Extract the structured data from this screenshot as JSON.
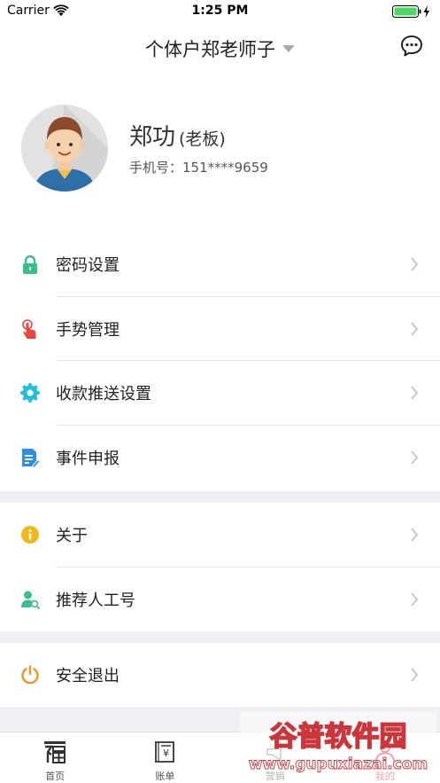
{
  "status_bar": {
    "carrier": "Carrier",
    "time": "1:25 PM"
  },
  "nav": {
    "title": "个体户郑老师子"
  },
  "profile": {
    "name": "郑功",
    "role": "(老板)",
    "phone": "手机号：151****9659"
  },
  "menu_group_1": [
    {
      "label": "密码设置",
      "icon": "lock-icon",
      "color": "#3bbf8a"
    },
    {
      "label": "手势管理",
      "icon": "hand-tap-icon",
      "color": "#e8453c"
    },
    {
      "label": "收款推送设置",
      "icon": "gear-icon",
      "color": "#1fc0d6"
    },
    {
      "label": "事件申报",
      "icon": "document-edit-icon",
      "color": "#2f8ce8"
    }
  ],
  "menu_group_2": [
    {
      "label": "关于",
      "icon": "info-icon",
      "color": "#f2b71b"
    },
    {
      "label": "推荐人工号",
      "icon": "user-search-icon",
      "color": "#3bbf8a"
    }
  ],
  "menu_group_3": [
    {
      "label": "安全退出",
      "icon": "power-icon",
      "color": "#f0932b"
    }
  ],
  "tabs": [
    {
      "label": "首页",
      "icon": "home-fu-icon"
    },
    {
      "label": "账单",
      "icon": "bill-icon"
    },
    {
      "label": "营销",
      "icon": "marketing-icon"
    },
    {
      "label": "我的",
      "icon": "profile-icon"
    }
  ],
  "watermark": {
    "line1": "谷普软件园",
    "line2": "www.gupuxiazai.com"
  },
  "colors": {
    "accent_red": "#d9363e",
    "gap_bg": "#efeff4"
  }
}
